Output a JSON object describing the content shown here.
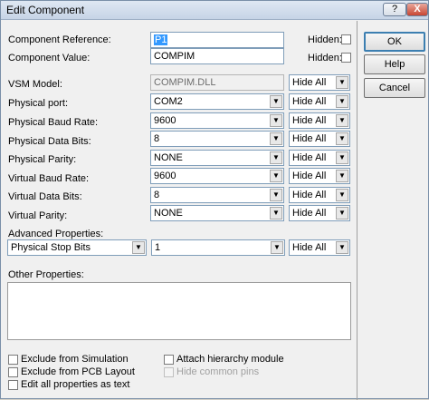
{
  "window": {
    "title": "Edit Component",
    "help_glyph": "?",
    "close_glyph": "X"
  },
  "labels": {
    "component_reference": "Component Reference:",
    "component_value": "Component Value:",
    "vsm_model": "VSM Model:",
    "physical_port": "Physical port:",
    "physical_baud_rate": "Physical Baud Rate:",
    "physical_data_bits": "Physical Data Bits:",
    "physical_parity": "Physical Parity:",
    "virtual_baud_rate": "Virtual Baud Rate:",
    "virtual_data_bits": "Virtual Data Bits:",
    "virtual_parity": "Virtual Parity:",
    "advanced_properties": "Advanced Properties:",
    "other_properties": "Other Properties:",
    "hidden1": "Hidden:",
    "hidden2": "Hidden:"
  },
  "values": {
    "component_reference": "P1",
    "component_value": "COMPIM",
    "vsm_model": "COMPIM.DLL",
    "physical_port": "COM2",
    "physical_baud_rate": "9600",
    "physical_data_bits": "8",
    "physical_parity": "NONE",
    "virtual_baud_rate": "9600",
    "virtual_data_bits": "8",
    "virtual_parity": "NONE",
    "advanced_property": "Physical Stop Bits",
    "advanced_value": "1"
  },
  "hide_all": "Hide All",
  "buttons": {
    "ok": "OK",
    "help": "Help",
    "cancel": "Cancel"
  },
  "checkboxes": {
    "exclude_simulation": "Exclude from Simulation",
    "exclude_pcb": "Exclude from PCB Layout",
    "edit_all": "Edit all properties as text",
    "attach_hierarchy": "Attach hierarchy module",
    "hide_common_pins": "Hide common pins"
  },
  "arrow_glyph": "▼"
}
